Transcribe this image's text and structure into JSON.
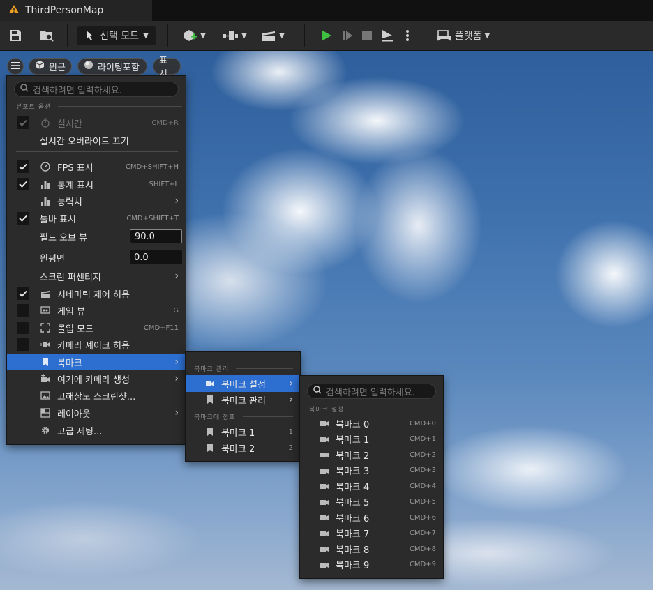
{
  "window": {
    "tab_title": "ThirdPersonMap",
    "tab_icon": "unreal-warning-icon"
  },
  "toolbar": {
    "select_mode_label": "선택 모드",
    "platform_label": "플랫폼",
    "play_color": "#3fbf3f"
  },
  "viewport_header": {
    "perspective_label": "원근",
    "lighting_label": "라이팅포함",
    "show_label": "표시"
  },
  "viewport_menu": {
    "search_placeholder": "검색하려면 입력하세요.",
    "section_title": "뷰포트 옵션",
    "items": [
      {
        "label": "실시간",
        "shortcut": "CMD+R",
        "checked": true,
        "disabled": true
      },
      {
        "label": "실시간 오버라이드 끄기"
      },
      {
        "label": "FPS 표시",
        "shortcut": "CMD+SHIFT+H",
        "checked": true
      },
      {
        "label": "통계 표시",
        "shortcut": "SHIFT+L",
        "checked": true
      },
      {
        "label": "능력치",
        "submenu": true
      },
      {
        "label": "툴바 표시",
        "shortcut": "CMD+SHIFT+T",
        "checked": true
      },
      {
        "label": "필드 오브 뷰",
        "value": "90.0"
      },
      {
        "label": "원평면",
        "value": "0.0"
      },
      {
        "label": "스크린 퍼센티지",
        "submenu": true
      },
      {
        "label": "시네마틱 제어 허용",
        "checked": true
      },
      {
        "label": "게임 뷰",
        "shortcut": "G",
        "checked": false
      },
      {
        "label": "몰입 모드",
        "shortcut": "CMD+F11",
        "checked": false
      },
      {
        "label": "카메라 셰이크 허용",
        "checked": false
      },
      {
        "label": "북마크",
        "submenu": true,
        "highlighted": true
      },
      {
        "label": "여기에 카메라 생성",
        "submenu": true
      },
      {
        "label": "고해상도 스크린샷..."
      },
      {
        "label": "레이아웃",
        "submenu": true
      },
      {
        "label": "고급 세팅..."
      }
    ]
  },
  "bookmark_menu": {
    "section_manage": "북마크 관리",
    "set_label": "북마크 설정",
    "manage_label": "북마크 관리",
    "section_jump": "북마크에 점프",
    "jump_items": [
      {
        "label": "북마크 1",
        "shortcut": "1"
      },
      {
        "label": "북마크 2",
        "shortcut": "2"
      }
    ]
  },
  "set_bookmark_menu": {
    "search_placeholder": "검색하려면 입력하세요.",
    "section_title": "북마크 설정",
    "items": [
      {
        "label": "북마크 0",
        "shortcut": "CMD+0"
      },
      {
        "label": "북마크 1",
        "shortcut": "CMD+1"
      },
      {
        "label": "북마크 2",
        "shortcut": "CMD+2"
      },
      {
        "label": "북마크 3",
        "shortcut": "CMD+3"
      },
      {
        "label": "북마크 4",
        "shortcut": "CMD+4"
      },
      {
        "label": "북마크 5",
        "shortcut": "CMD+5"
      },
      {
        "label": "북마크 6",
        "shortcut": "CMD+6"
      },
      {
        "label": "북마크 7",
        "shortcut": "CMD+7"
      },
      {
        "label": "북마크 8",
        "shortcut": "CMD+8"
      },
      {
        "label": "북마크 9",
        "shortcut": "CMD+9"
      }
    ]
  }
}
